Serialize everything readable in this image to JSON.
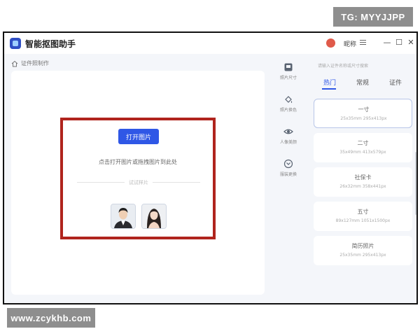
{
  "watermarks": {
    "top_right": "TG: MYYJJPP",
    "bottom_left": "www.zcykhb.com"
  },
  "titlebar": {
    "app_title": "智能抠图助手",
    "user_name": "昵称",
    "icons": [
      "app-logo-icon",
      "user-avatar-icon",
      "menu-icon",
      "minimize-icon",
      "maximize-icon",
      "close-icon"
    ],
    "min_glyph": "—",
    "max_glyph": "☐",
    "close_glyph": "✕"
  },
  "breadcrumb": {
    "label": "证件照制作"
  },
  "upload": {
    "open_button": "打开图片",
    "hint": "点击打开图片或拖拽图片到此处",
    "try_label": "试试样片"
  },
  "tools": [
    {
      "label": "照片尺寸",
      "icon": "photo-size-icon"
    },
    {
      "label": "照片换色",
      "icon": "color-fill-icon"
    },
    {
      "label": "人像美颜",
      "icon": "eye-beauty-icon"
    },
    {
      "label": "服装更换",
      "icon": "clothes-swap-icon"
    }
  ],
  "side_panel": {
    "search_hint": "请输入证件名称或尺寸搜索",
    "tabs": [
      "热门",
      "常规",
      "证件"
    ],
    "active_tab": "热门",
    "sizes": [
      {
        "name": "一寸",
        "dims": "25x35mm    295x413px",
        "selected": true
      },
      {
        "name": "二寸",
        "dims": "35x49mm    413x579px",
        "selected": false
      },
      {
        "name": "社保卡",
        "dims": "26x32mm    358x441px",
        "selected": false
      },
      {
        "name": "五寸",
        "dims": "89x127mm    1051x1500px",
        "selected": false
      },
      {
        "name": "简历照片",
        "dims": "25x35mm    295x413px",
        "selected": false
      }
    ]
  },
  "colors": {
    "accent": "#2f57e6",
    "highlight_border": "#b0241d",
    "panel_bg": "#f4f6fa"
  }
}
